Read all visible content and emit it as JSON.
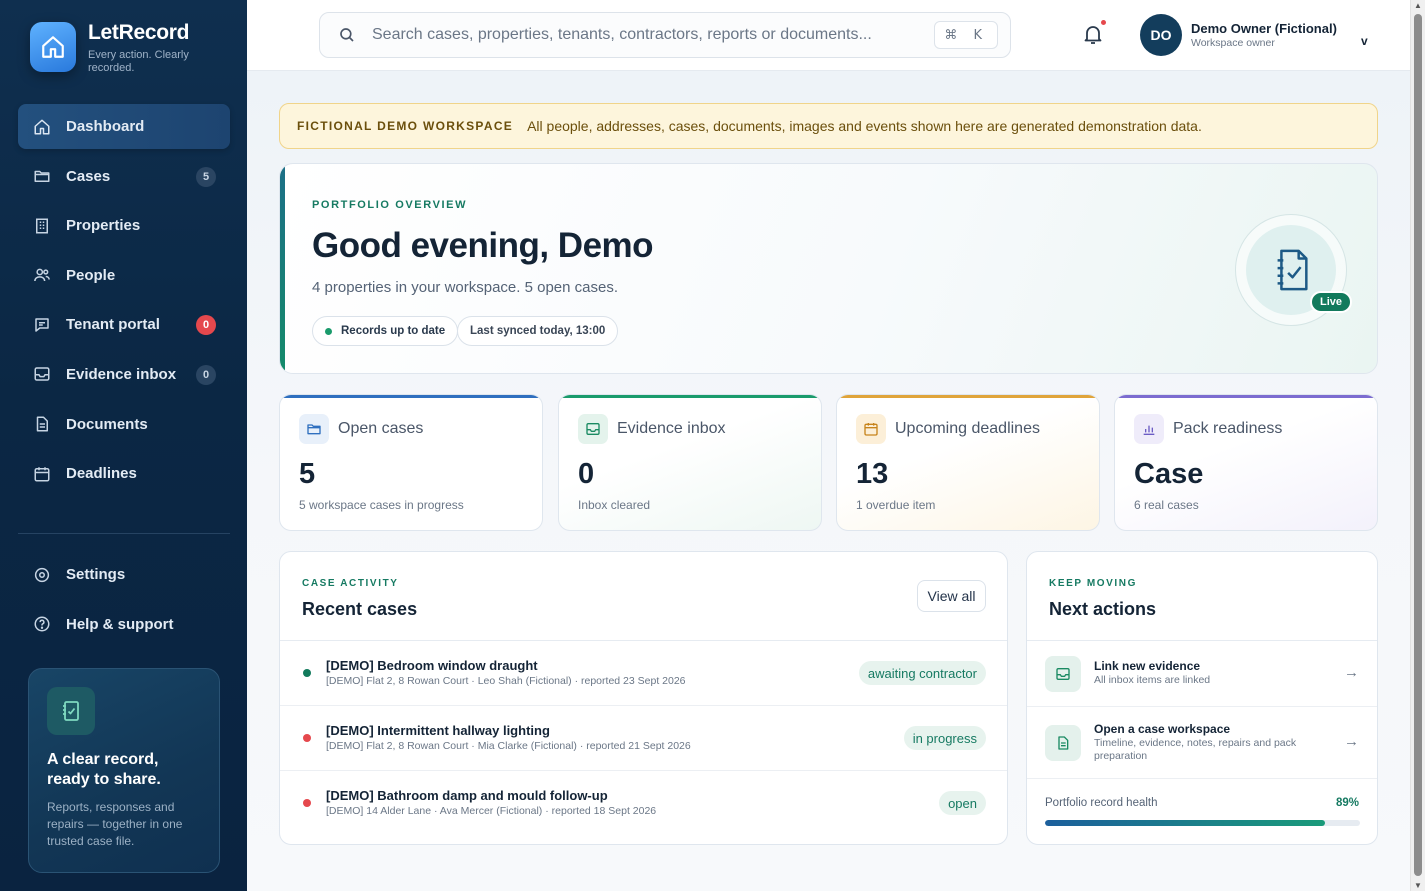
{
  "brand": {
    "name": "LetRecord",
    "tagline": "Every action. Clearly recorded.",
    "icon": "home-icon"
  },
  "nav": {
    "items": [
      {
        "label": "Dashboard",
        "icon": "home-icon",
        "active": true,
        "badge": null
      },
      {
        "label": "Cases",
        "icon": "folder-icon",
        "badge": "5"
      },
      {
        "label": "Properties",
        "icon": "building-icon",
        "badge": null
      },
      {
        "label": "People",
        "icon": "users-icon",
        "badge": null
      },
      {
        "label": "Tenant portal",
        "icon": "chat-icon",
        "badge": "0",
        "badge_color": "#e5484d"
      },
      {
        "label": "Evidence inbox",
        "icon": "inbox-icon",
        "badge": "0"
      },
      {
        "label": "Documents",
        "icon": "document-icon",
        "badge": null
      },
      {
        "label": "Deadlines",
        "icon": "calendar-icon",
        "badge": null
      }
    ],
    "secondary": [
      {
        "label": "Settings",
        "icon": "gear-icon"
      },
      {
        "label": "Help & support",
        "icon": "help-icon"
      }
    ]
  },
  "promo": {
    "title": "A clear record, ready to share.",
    "text": "Reports, responses and repairs — together in one trusted case file.",
    "icon": "notebook-check-icon"
  },
  "search": {
    "placeholder": "Search cases, properties, tenants, contractors, reports or documents...",
    "shortcut": "⌘ K"
  },
  "user": {
    "initials": "DO",
    "name": "Demo Owner (Fictional)",
    "role": "Workspace owner",
    "chevron": "v"
  },
  "banner": {
    "title": "FICTIONAL DEMO WORKSPACE",
    "text": "All people, addresses, cases, documents, images and events shown here are generated demonstration data."
  },
  "hero": {
    "eyebrow": "PORTFOLIO OVERVIEW",
    "title": "Good evening, Demo",
    "subtitle": "4 properties in your workspace. 5 open cases.",
    "pill_status": "Records up to date",
    "pill_sync": "Last synced today, 13:00",
    "badge": "Live"
  },
  "stats": [
    {
      "label": "Open cases",
      "value": "5",
      "sub": "5 workspace cases in progress",
      "icon": "folder-icon",
      "accent": "#2f6fbf"
    },
    {
      "label": "Evidence inbox",
      "value": "0",
      "sub": "Inbox cleared",
      "icon": "inbox-icon",
      "accent": "#1a9b6c"
    },
    {
      "label": "Upcoming deadlines",
      "value": "13",
      "sub": "1 overdue item",
      "icon": "calendar-icon",
      "accent": "#e0a43a"
    },
    {
      "label": "Pack readiness",
      "value": "Case",
      "sub": "6 real cases",
      "icon": "chart-icon",
      "accent": "#7c6cd0"
    }
  ],
  "recent": {
    "eyebrow": "CASE ACTIVITY",
    "title": "Recent cases",
    "view_all": "View all",
    "cases": [
      {
        "title": "[DEMO] Bedroom window draught",
        "meta": "[DEMO] Flat 2, 8 Rowan Court · Leo Shah (Fictional) · reported 23 Sept 2026",
        "status": "awaiting contractor",
        "dot_color": "#127a5c"
      },
      {
        "title": "[DEMO] Intermittent hallway lighting",
        "meta": "[DEMO] Flat 2, 8 Rowan Court · Mia Clarke (Fictional) · reported 21 Sept 2026",
        "status": "in progress",
        "dot_color": "#e5484d"
      },
      {
        "title": "[DEMO] Bathroom damp and mould follow-up",
        "meta": "[DEMO] 14 Alder Lane · Ava Mercer (Fictional) · reported 18 Sept 2026",
        "status": "open",
        "dot_color": "#e5484d"
      }
    ]
  },
  "next": {
    "eyebrow": "KEEP MOVING",
    "title": "Next actions",
    "actions": [
      {
        "title": "Link new evidence",
        "sub": "All inbox items are linked",
        "icon": "inbox-icon",
        "arrow": "→"
      },
      {
        "title": "Open a case workspace",
        "sub": "Timeline, evidence, notes, repairs and pack preparation",
        "icon": "document-icon",
        "arrow": "→"
      }
    ],
    "health_label": "Portfolio record health",
    "health_value": "89%",
    "health_fraction": 0.89
  }
}
